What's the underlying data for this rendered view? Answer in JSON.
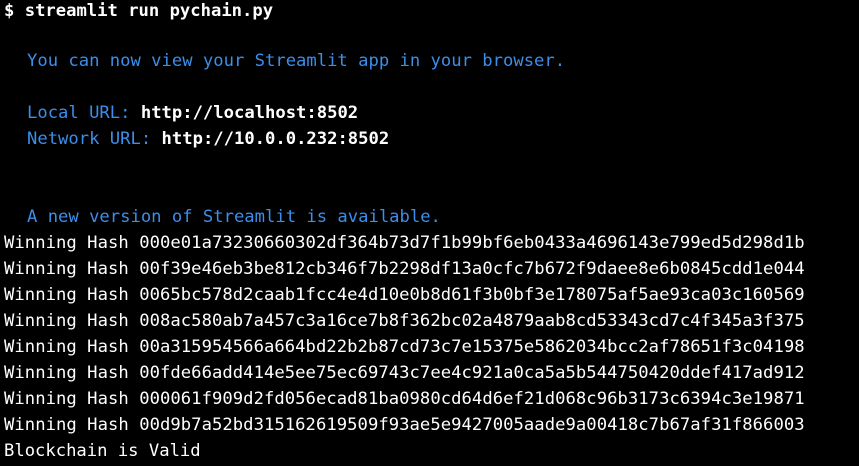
{
  "colors": {
    "background": "#000000",
    "text": "#ffffff",
    "info_blue": "#3b8eea"
  },
  "command": {
    "prompt": "$",
    "text": "streamlit run pychain.py"
  },
  "streamlit": {
    "view_message": "You can now view your Streamlit app in your browser.",
    "local_label": "Local URL:",
    "local_url": "http://localhost:8502",
    "network_label": "Network URL:",
    "network_url": "http://10.0.0.232:8502",
    "update_message": "A new version of Streamlit is available."
  },
  "hash_label": "Winning Hash",
  "hashes": [
    "000e01a73230660302df364b73d7f1b99bf6eb0433a4696143e799ed5d298d1b",
    "00f39e46eb3be812cb346f7b2298df13a0cfc7b672f9daee8e6b0845cdd1e044",
    "0065bc578d2caab1fcc4e4d10e0b8d61f3b0bf3e178075af5ae93ca03c160569",
    "008ac580ab7a457c3a16ce7b8f362bc02a4879aab8cd53343cd7c4f345a3f375",
    "00a315954566a664bd22b2b87cd73c7e15375e5862034bcc2af78651f3c04198",
    "00fde66add414e5ee75ec69743c7ee4c921a0ca5a5b544750420ddef417ad912",
    "000061f909d2fd056ecad81ba0980cd64d6ef21d068c96b3173c6394c3e19871",
    "00d9b7a52bd315162619509f93ae5e9427005aade9a00418c7b67af31f866003"
  ],
  "validation_message": "Blockchain is Valid"
}
